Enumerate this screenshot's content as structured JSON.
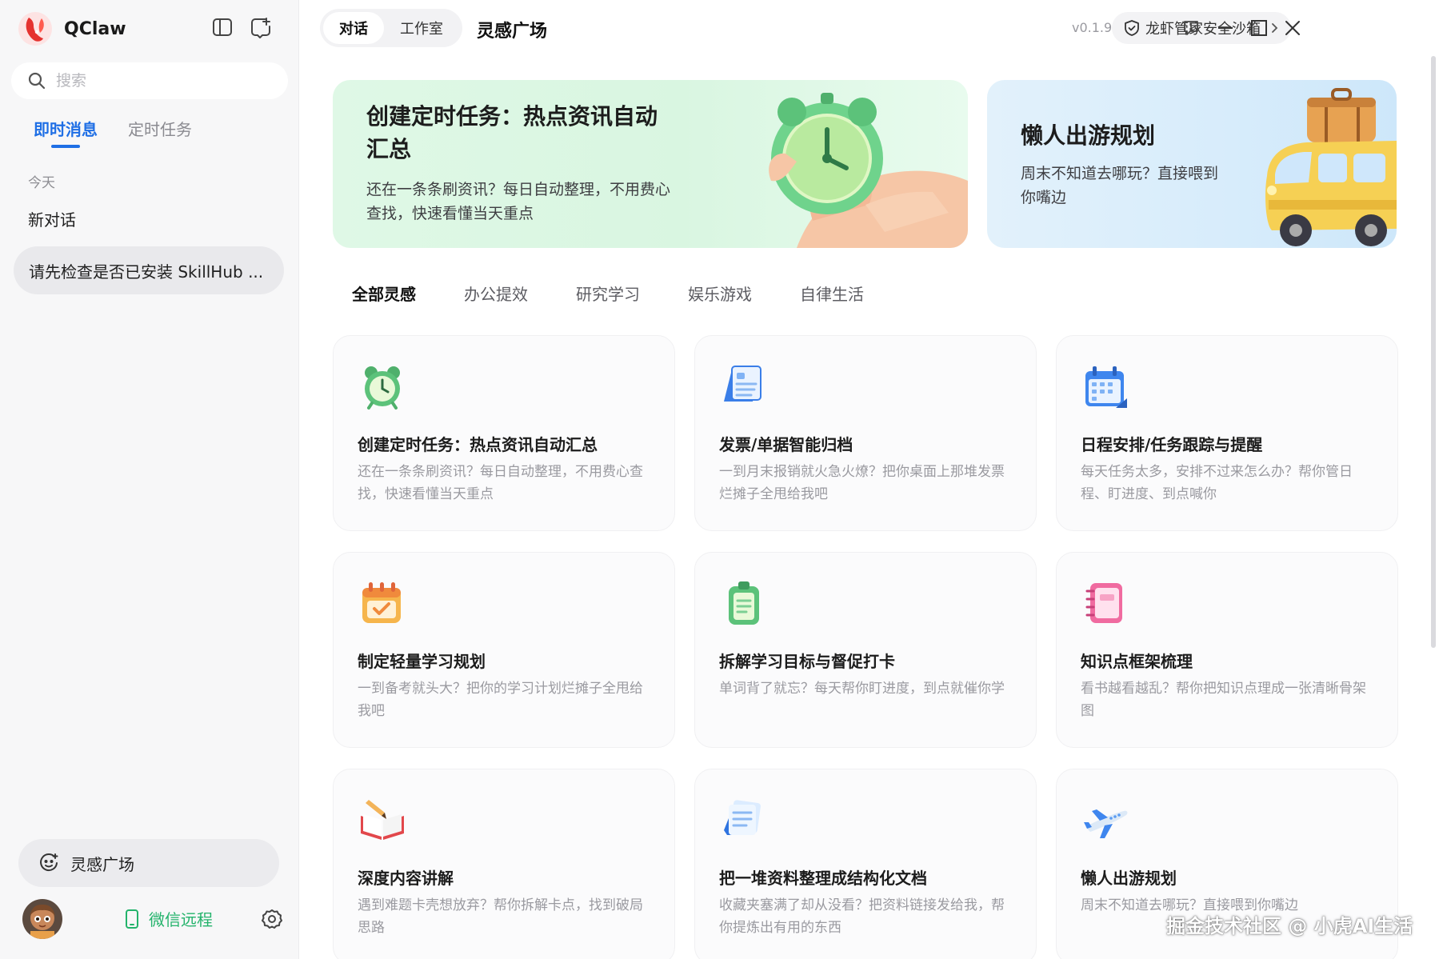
{
  "app": {
    "name": "QClaw"
  },
  "sidebar": {
    "search_placeholder": "搜索",
    "tabs": [
      {
        "label": "即时消息"
      },
      {
        "label": "定时任务"
      }
    ],
    "section_today": "今天",
    "conversations": [
      {
        "label": "新对话"
      },
      {
        "label": "请先检查是否已安装 SkillHub ..."
      }
    ],
    "inspiration_button": "灵感广场",
    "wechat_remote": "微信远程"
  },
  "header": {
    "tabs": [
      {
        "label": "对话"
      },
      {
        "label": "工作室"
      }
    ],
    "title": "灵感广场",
    "version": "v0.1.9",
    "sandbox_label": "龙虾管家安全沙箱"
  },
  "banners": [
    {
      "title": "创建定时任务：热点资讯自动汇总",
      "desc": "还在一条条刷资讯？每日自动整理，不用费心查找，快速看懂当天重点"
    },
    {
      "title": "懒人出游规划",
      "desc": "周末不知道去哪玩？直接喂到你嘴边"
    }
  ],
  "categories": [
    {
      "label": "全部灵感"
    },
    {
      "label": "办公提效"
    },
    {
      "label": "研究学习"
    },
    {
      "label": "娱乐游戏"
    },
    {
      "label": "自律生活"
    }
  ],
  "cards": [
    {
      "icon": "alarm-clock-icon",
      "title": "创建定时任务：热点资讯自动汇总",
      "desc": "还在一条条刷资讯？每日自动整理，不用费心查找，快速看懂当天重点"
    },
    {
      "icon": "document-icon",
      "title": "发票/单据智能归档",
      "desc": "一到月末报销就火急火燎？把你桌面上那堆发票烂摊子全甩给我吧"
    },
    {
      "icon": "calendar-icon",
      "title": "日程安排/任务跟踪与提醒",
      "desc": "每天任务太多，安排不过来怎么办？帮你管日程、盯进度、到点喊你"
    },
    {
      "icon": "calendar-check-icon",
      "title": "制定轻量学习规划",
      "desc": "一到备考就头大？把你的学习计划烂摊子全甩给我吧"
    },
    {
      "icon": "clipboard-icon",
      "title": "拆解学习目标与督促打卡",
      "desc": "单词背了就忘？每天帮你盯进度，到点就催你学"
    },
    {
      "icon": "notebook-icon",
      "title": "知识点框架梳理",
      "desc": "看书越看越乱？帮你把知识点理成一张清晰骨架图"
    },
    {
      "icon": "open-book-icon",
      "title": "深度内容讲解",
      "desc": "遇到难题卡壳想放弃？帮你拆解卡点，找到破局思路"
    },
    {
      "icon": "documents-stack-icon",
      "title": "把一堆资料整理成结构化文档",
      "desc": "收藏夹塞满了却从没看？把资料链接发给我，帮你提炼出有用的东西"
    },
    {
      "icon": "airplane-icon",
      "title": "懒人出游规划",
      "desc": "周末不知道去哪玩？直接喂到你嘴边"
    }
  ],
  "watermark": "掘金技术社区 @ 小虎AI生活",
  "colors": {
    "accent": "#1f6fe5",
    "wechat_green": "#23b36b",
    "sidebar_bg": "#f7f7f8"
  }
}
